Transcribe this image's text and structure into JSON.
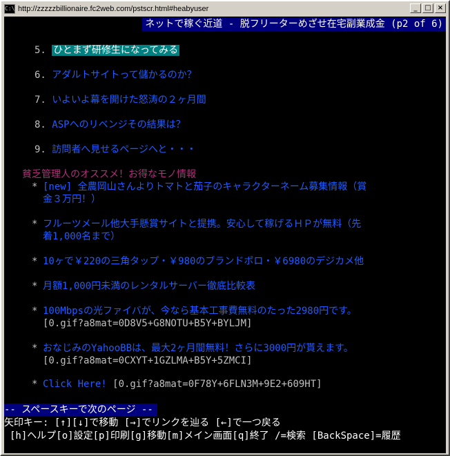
{
  "window": {
    "title": "http://zzzzzbillionaire.fc2web.com/pstscr.html#heabyuser",
    "app_icon": "C:\\",
    "controls": {
      "minimize": "_",
      "maximize": "□",
      "close": "×"
    }
  },
  "header": {
    "title": "ネットで稼ぐ近道 - 脱フリーターめざせ在宅副業成金 (p2 of 6)"
  },
  "menu_items": [
    {
      "num": "5.",
      "label": "ひとまず研修生になってみる",
      "selected": true
    },
    {
      "num": "6.",
      "label": "アダルトサイトって儲かるのか？"
    },
    {
      "num": "7.",
      "label": "いよいよ幕を開けた怒涛の２ヶ月間"
    },
    {
      "num": "8.",
      "label": "ASPへのリベンジその結果は？"
    },
    {
      "num": "9.",
      "label": "訪問者へ見せるページへと・・・"
    }
  ],
  "section": {
    "title": "貧乏管理人のオススメ！お得なモノ情報"
  },
  "bullets": [
    {
      "star": "*",
      "lines": [
        "[new] 全農岡山さんよりトマトと茄子のキャラクターネーム募集情報（賞",
        "金３万円！）"
      ],
      "extra": ""
    },
    {
      "star": "*",
      "lines": [
        "フルーツメール他大手懸賞サイトと提携。安心して稼げるＨＰが無料（先",
        "着1,000名まで）"
      ],
      "extra": ""
    },
    {
      "star": "*",
      "lines": [
        "10ヶで￥220の三角タップ・￥980のブランドポロ・￥6980のデジカメ他"
      ],
      "extra": ""
    },
    {
      "star": "*",
      "lines": [
        "月額1,000円未満のレンタルサーバー徹底比較表"
      ],
      "extra": ""
    },
    {
      "star": "*",
      "lines": [
        "100Mbpsの光ファイバが、今なら基本工事費無料のたった2980円です。"
      ],
      "extra": "[0.gif?a8mat=0D8V5+G8NOTU+B5Y+BYLJM]"
    },
    {
      "star": "*",
      "lines": [
        "おなじみのYahooBBは、最大2ヶ月間無料！さらに3000円が貰えます。"
      ],
      "extra": "[0.gif?a8mat=0CXYT+1GZLMA+B5Y+5ZMCI]"
    },
    {
      "star": "*",
      "lines": [
        "Click Here!"
      ],
      "extra": " [0.gif?a8mat=0F78Y+6FLN3M+9E2+609HT]"
    }
  ],
  "footer": {
    "prompt": "-- スペースキーで次のページ --",
    "line1": " 矢印キー: [↑][↓]で移動 [→]でリンクを辿る [←]で一つ戻る",
    "line2": "[h]ヘルプ[o]設定[p]印刷[g]移動[m]メイン画面[q]終了 /=検索 [BackSpace]=履歴"
  }
}
